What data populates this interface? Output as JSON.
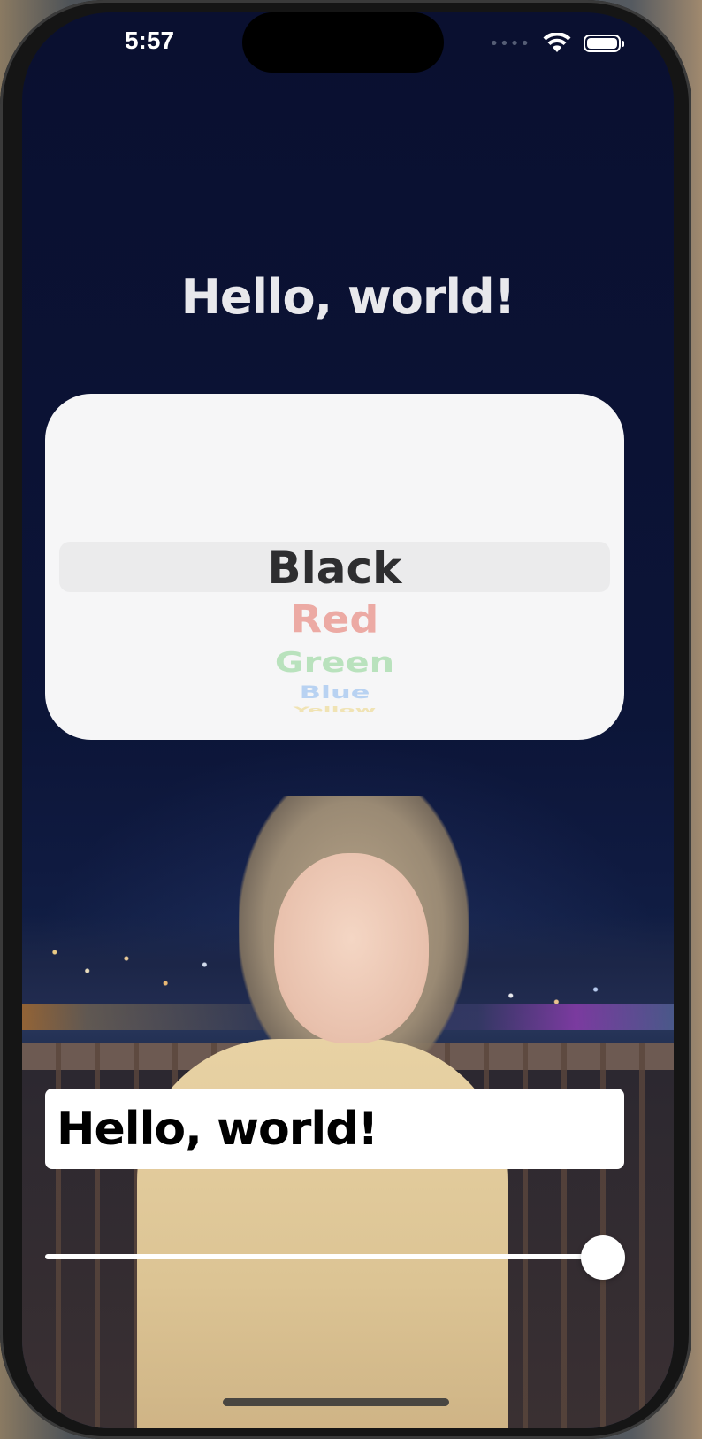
{
  "status_bar": {
    "time": "5:57",
    "signal": "••••",
    "wifi_icon": "wifi-icon",
    "battery_icon": "battery-icon"
  },
  "main": {
    "title": "Hello, world!"
  },
  "picker": {
    "selected": "Black",
    "items": [
      "Black",
      "Red",
      "Green",
      "Blue",
      "Yellow"
    ],
    "colors": {
      "Black": "#2e2e30",
      "Red": "#ecaaa4",
      "Green": "#b9e2bd",
      "Blue": "#b8d2f2",
      "Yellow": "#f0e3b4"
    }
  },
  "text_field": {
    "value": "Hello, world!"
  },
  "slider": {
    "value": 1.0
  }
}
